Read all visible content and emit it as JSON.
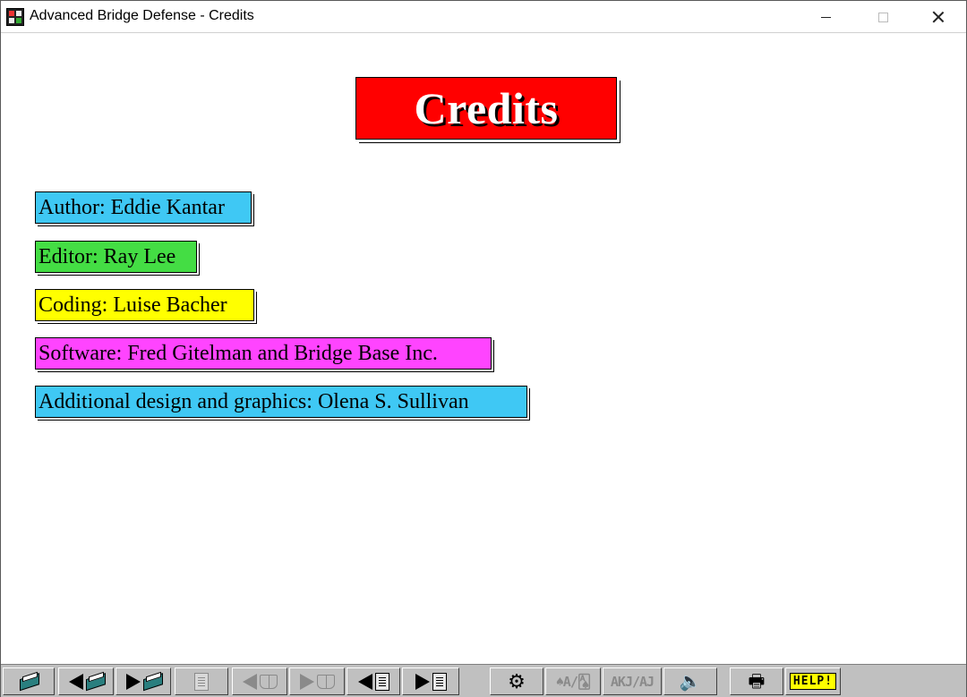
{
  "window": {
    "title": "Advanced Bridge Defense - Credits"
  },
  "page": {
    "heading": "Credits",
    "credits": [
      {
        "label": "Author: Eddie Kantar",
        "color": "#3fc8f4"
      },
      {
        "label": "Editor: Ray Lee",
        "color": "#44dd44"
      },
      {
        "label": "Coding: Luise Bacher",
        "color": "#ffff00"
      },
      {
        "label": "Software: Fred Gitelman and Bridge Base Inc.",
        "color": "#ff44ff"
      },
      {
        "label": "Additional design and graphics: Olena S. Sullivan",
        "color": "#3fc8f4"
      }
    ]
  },
  "toolbar": {
    "buttons": [
      {
        "name": "contents",
        "icon": "book-icon",
        "enabled": true
      },
      {
        "name": "previous-chapter",
        "icon": "left-arrow-book-icon",
        "enabled": true
      },
      {
        "name": "next-chapter",
        "icon": "right-arrow-book-icon",
        "enabled": true
      },
      {
        "name": "page-view",
        "icon": "page-icon",
        "enabled": false
      },
      {
        "name": "previous-deal",
        "icon": "left-arrow-openbook-icon",
        "enabled": false
      },
      {
        "name": "next-deal",
        "icon": "right-arrow-openbook-icon",
        "enabled": false
      },
      {
        "name": "previous-page",
        "icon": "left-arrow-page-icon",
        "enabled": true
      },
      {
        "name": "next-page",
        "icon": "right-arrow-page-icon",
        "enabled": true
      },
      {
        "name": "settings",
        "icon": "gear-icon",
        "enabled": true
      },
      {
        "name": "suit-symbols",
        "label": "♠A/🂡",
        "enabled": false
      },
      {
        "name": "card-notation",
        "label": "AKJ/AJ",
        "enabled": false
      },
      {
        "name": "sound",
        "icon": "speaker-icon",
        "enabled": true
      },
      {
        "name": "print",
        "icon": "printer-icon",
        "enabled": true
      },
      {
        "name": "help",
        "label": "HELP!",
        "enabled": true
      }
    ]
  }
}
